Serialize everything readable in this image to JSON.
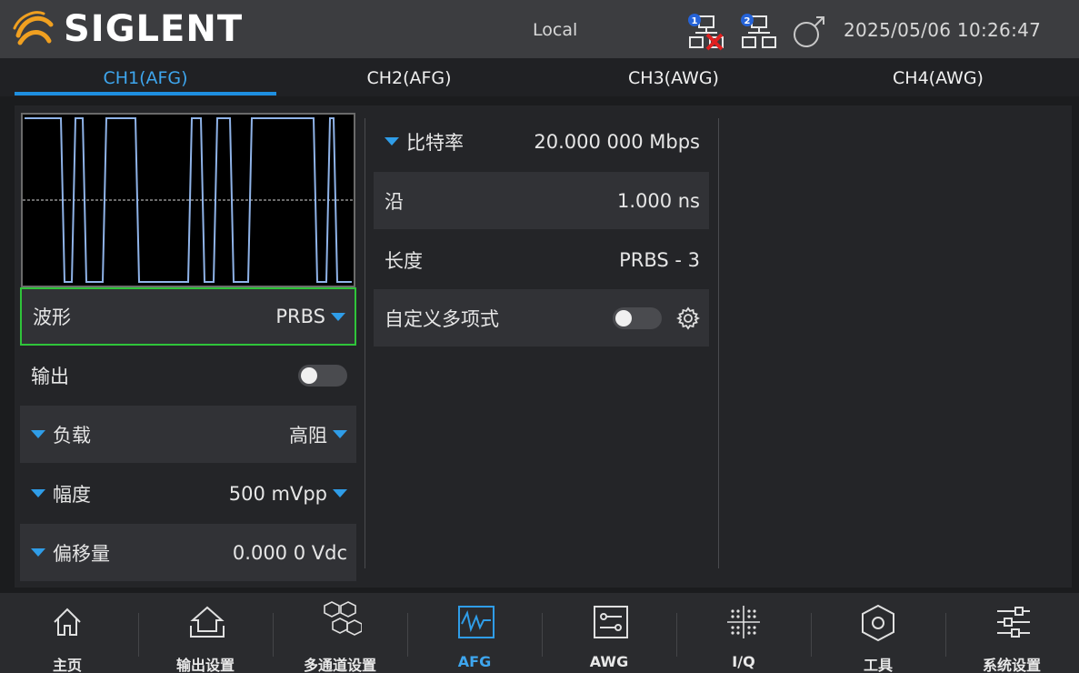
{
  "header": {
    "brand": "SIGLENT",
    "mode": "Local",
    "lan1_badge": "1",
    "lan2_badge": "2",
    "datetime": "2025/05/06 10:26:47"
  },
  "tabs": [
    {
      "label": "CH1(AFG)",
      "active": true
    },
    {
      "label": "CH2(AFG)",
      "active": false
    },
    {
      "label": "CH3(AWG)",
      "active": false
    },
    {
      "label": "CH4(AWG)",
      "active": false
    }
  ],
  "left_panel": {
    "waveform_label": "波形",
    "waveform_value": "PRBS",
    "output_label": "输出",
    "output_on": false,
    "load_label": "负载",
    "load_value": "高阻",
    "amplitude_label": "幅度",
    "amplitude_value": "500 mVpp",
    "offset_label": "偏移量",
    "offset_value": "0.000 0  Vdc"
  },
  "params": {
    "bitrate_label": "比特率",
    "bitrate_value": "20.000 000 Mbps",
    "edge_label": "沿",
    "edge_value": "1.000  ns",
    "length_label": "长度",
    "length_value": "PRBS - 3",
    "custom_poly_label": "自定义多项式",
    "custom_poly_on": false
  },
  "bottom_nav": [
    {
      "label": "主页",
      "icon": "home-icon",
      "active": false
    },
    {
      "label": "输出设置",
      "icon": "output-settings-icon",
      "active": false
    },
    {
      "label": "多通道设置",
      "icon": "multichannel-icon",
      "active": false
    },
    {
      "label": "AFG",
      "icon": "afg-wave-icon",
      "active": true
    },
    {
      "label": "AWG",
      "icon": "awg-icon",
      "active": false
    },
    {
      "label": "I/Q",
      "icon": "iq-constellation-icon",
      "active": false
    },
    {
      "label": "工具",
      "icon": "tools-icon",
      "active": false
    },
    {
      "label": "系统设置",
      "icon": "system-settings-icon",
      "active": false
    }
  ],
  "colors": {
    "accent": "#2f9de8",
    "selected_border": "#2fc43a",
    "waveform": "#8fb3e8",
    "error_red": "#e02020"
  }
}
